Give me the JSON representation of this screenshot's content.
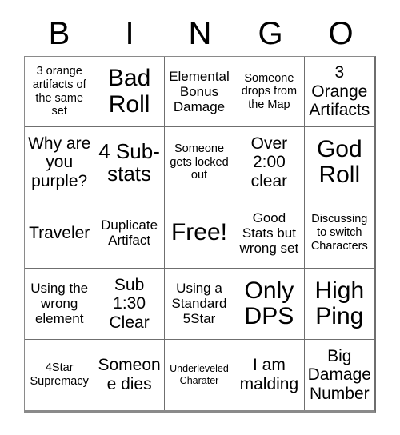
{
  "card": {
    "title_letters": [
      "B",
      "I",
      "N",
      "G",
      "O"
    ],
    "columns": 5,
    "rows": 5,
    "free_space_index": 12,
    "colors": {
      "background": "#ffffff",
      "text": "#000000",
      "grid_line": "#6f6f6f",
      "grid_outer": "#8a8a8a"
    },
    "cells": [
      {
        "text": "3 orange artifacts of the same set",
        "size": "fs-sm"
      },
      {
        "text": "Bad Roll",
        "size": "fs-xxl"
      },
      {
        "text": "Elemental Bonus Damage",
        "size": "fs-md"
      },
      {
        "text": "Someone drops from the Map",
        "size": "fs-sm"
      },
      {
        "text": "3 Orange Artifacts",
        "size": "fs-lg"
      },
      {
        "text": "Why are you purple?",
        "size": "fs-lg"
      },
      {
        "text": "4 Sub-stats",
        "size": "fs-xl"
      },
      {
        "text": "Someone gets locked out",
        "size": "fs-sm"
      },
      {
        "text": "Over 2:00 clear",
        "size": "fs-lg"
      },
      {
        "text": "God Roll",
        "size": "fs-xxl"
      },
      {
        "text": "Traveler",
        "size": "fs-lg"
      },
      {
        "text": "Duplicate Artifact",
        "size": "fs-md"
      },
      {
        "text": "Free!",
        "size": "fs-xxl"
      },
      {
        "text": "Good Stats but wrong set",
        "size": "fs-md"
      },
      {
        "text": "Discussing to switch Characters",
        "size": "fs-sm"
      },
      {
        "text": "Using the wrong element",
        "size": "fs-md"
      },
      {
        "text": "Sub 1:30 Clear",
        "size": "fs-lg"
      },
      {
        "text": "Using a Standard 5Star",
        "size": "fs-md"
      },
      {
        "text": "Only DPS",
        "size": "fs-xxl"
      },
      {
        "text": "High Ping",
        "size": "fs-xxl"
      },
      {
        "text": "4Star Supremacy",
        "size": "fs-sm"
      },
      {
        "text": "Someone dies",
        "size": "fs-lg"
      },
      {
        "text": "Underleveled Charater",
        "size": "fs-xs"
      },
      {
        "text": "I am malding",
        "size": "fs-lg"
      },
      {
        "text": "Big Damage Number",
        "size": "fs-lg"
      }
    ]
  }
}
